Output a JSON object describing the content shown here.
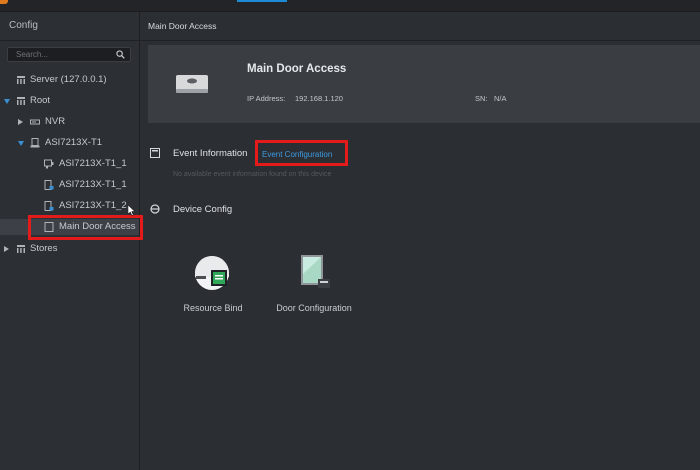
{
  "sidebar": {
    "title": "Config",
    "search_placeholder": "Search...",
    "items": [
      {
        "label": "Server (127.0.0.1)"
      },
      {
        "label": "Root"
      },
      {
        "label": "NVR"
      },
      {
        "label": "ASI7213X-T1"
      },
      {
        "label": "ASI7213X-T1_1"
      },
      {
        "label": "ASI7213X-T1_1"
      },
      {
        "label": "ASI7213X-T1_2"
      },
      {
        "label": "Main Door Access"
      },
      {
        "label": "Stores"
      }
    ]
  },
  "main": {
    "header_title": "Main Door Access",
    "device": {
      "name": "Main Door Access",
      "ip_label": "IP Address:",
      "ip_value": "192.168.1.120",
      "sn_label": "SN:",
      "sn_value": "N/A"
    },
    "event_section": {
      "title": "Event Information",
      "link": "Event Configuration",
      "empty_text": "No available event information found on this device"
    },
    "device_config": {
      "title": "Device Config",
      "tiles": [
        {
          "label": "Resource Bind",
          "icon": "resource-bind-icon"
        },
        {
          "label": "Door Configuration",
          "icon": "door-configuration-icon"
        }
      ]
    }
  },
  "colors": {
    "accent": "#3d9be0",
    "highlight": "#e41b1b",
    "background": "#2b2e32",
    "card": "#3a3e43"
  }
}
